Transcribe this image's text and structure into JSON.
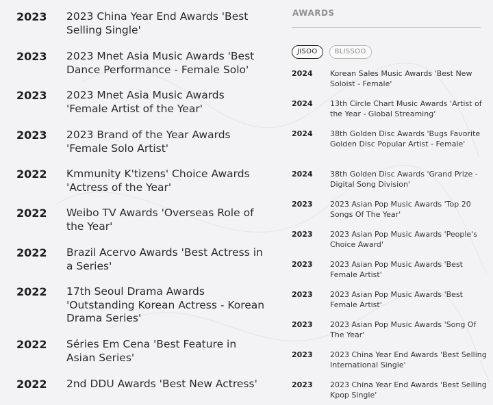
{
  "left_awards": [
    {
      "year": "2023",
      "title": "2023 China Year End Awards 'Best Selling Single'"
    },
    {
      "year": "2023",
      "title": "2023 Mnet Asia Music Awards 'Best Dance Performance - Female Solo'"
    },
    {
      "year": "2023",
      "title": "2023 Mnet Asia Music Awards 'Female Artist of the Year'"
    },
    {
      "year": "2023",
      "title": "2023 Brand of the Year Awards 'Female Solo Artist'"
    },
    {
      "year": "2022",
      "title": "Kmmunity K'tizens' Choice Awards 'Actress of the Year'"
    },
    {
      "year": "2022",
      "title": "Weibo TV Awards 'Overseas Role of the Year'"
    },
    {
      "year": "2022",
      "title": "Brazil Acervo Awards 'Best Actress in a Series'"
    },
    {
      "year": "2022",
      "title": "17th Seoul Drama Awards 'Outstanding Korean Actress - Korean Drama Series'"
    },
    {
      "year": "2022",
      "title": "Séries Em Cena 'Best Feature in Asian Series'"
    },
    {
      "year": "2022",
      "title": "2nd DDU Awards 'Best New Actress'"
    }
  ],
  "sidebar": {
    "heading": "AWARDS",
    "tabs": [
      {
        "label": "JISOO",
        "active": true
      },
      {
        "label": "BLISSOO",
        "active": false
      }
    ],
    "awards": [
      {
        "year": "2024",
        "title": "Korean Sales Music Awards 'Best New Soloist - Female'"
      },
      {
        "year": "2024",
        "title": "13th Circle Chart Music Awards 'Artist of the Year - Global Streaming'"
      },
      {
        "year": "2024",
        "title": "38th Golden Disc Awards 'Bugs Favorite Golden Disc Popular Artist - Female'"
      },
      {
        "year": "2024",
        "title": "38th Golden Disc Awards 'Grand Prize - Digital Song Division'"
      },
      {
        "year": "2023",
        "title": "2023 Asian Pop Music Awards 'Top 20 Songs Of The Year'"
      },
      {
        "year": "2023",
        "title": "2023 Asian Pop Music Awards 'People's Choice Award'"
      },
      {
        "year": "2023",
        "title": "2023 Asian Pop Music Awards 'Best Female Artist'"
      },
      {
        "year": "2023",
        "title": "2023 Asian Pop Music Awards 'Best Female Artist'"
      },
      {
        "year": "2023",
        "title": "2023 Asian Pop Music Awards 'Song Of The Year'"
      },
      {
        "year": "2023",
        "title": "2023 China Year End Awards 'Best Selling International Single'"
      },
      {
        "year": "2023",
        "title": "2023 China Year End Awards 'Best Selling Kpop Single'"
      }
    ]
  }
}
